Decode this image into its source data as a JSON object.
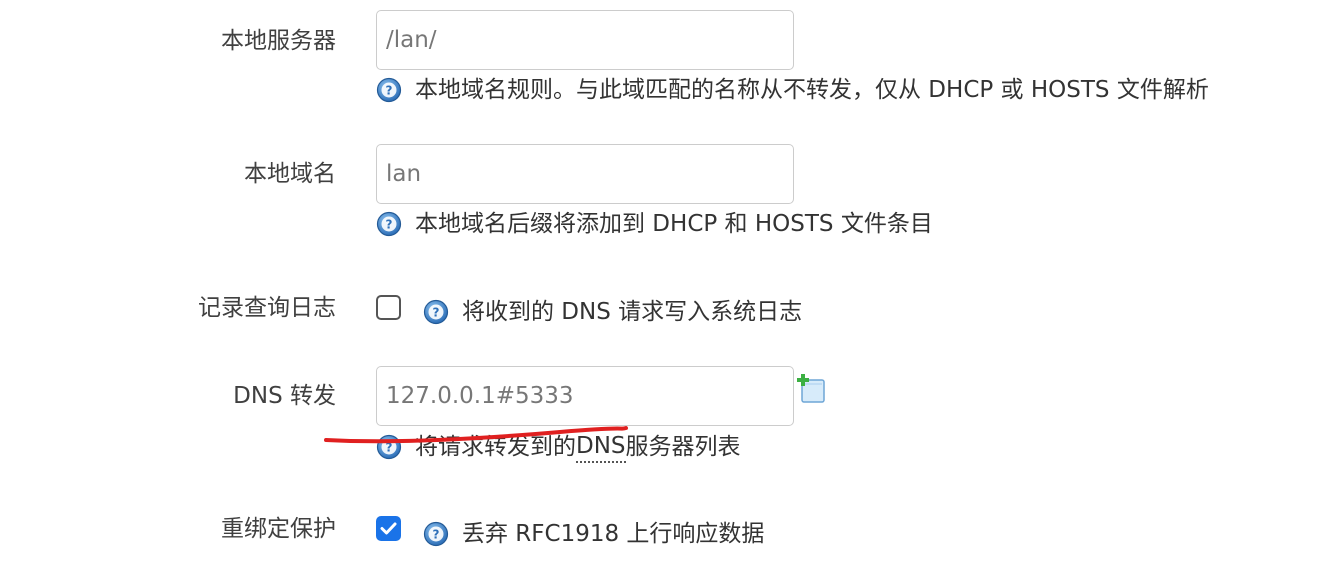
{
  "rows": {
    "local_server": {
      "label": "本地服务器",
      "value": "/lan/",
      "help": "本地域名规则。与此域匹配的名称从不转发，仅从 DHCP 或 HOSTS 文件解析"
    },
    "local_domain": {
      "label": "本地域名",
      "value": "lan",
      "help": "本地域名后缀将添加到 DHCP 和 HOSTS 文件条目"
    },
    "log_queries": {
      "label": "记录查询日志",
      "checked": false,
      "help": "将收到的 DNS 请求写入系统日志"
    },
    "dns_forward": {
      "label": "DNS 转发",
      "value": "127.0.0.1#5333",
      "help_prefix": "将请求转发到的 ",
      "help_abbr": "DNS",
      "help_suffix": " 服务器列表"
    },
    "rebind_protection": {
      "label": "重绑定保护",
      "checked": true,
      "help": "丢弃 RFC1918 上行响应数据"
    }
  },
  "icons": {
    "help": "help-question-icon",
    "add": "add-entry-icon",
    "check": "checkmark-icon"
  },
  "colors": {
    "checkbox_checked": "#1a73e8",
    "annotation": "#e02020",
    "help_icon": "#3a7cc4"
  }
}
